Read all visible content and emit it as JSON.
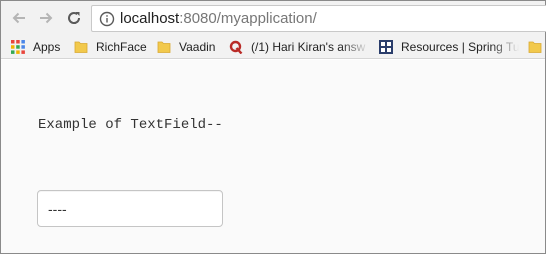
{
  "browser": {
    "url_host": "localhost",
    "url_rest": ":8080/myapplication/"
  },
  "bookmarks": {
    "items": [
      {
        "label": "Apps",
        "icon": "apps-grid-icon"
      },
      {
        "label": "RichFace",
        "icon": "folder-icon"
      },
      {
        "label": "Vaadin",
        "icon": "folder-icon"
      },
      {
        "label": "(/1) Hari Kiran's answ",
        "icon": "quora-icon"
      },
      {
        "label": "Resources | Spring Tu",
        "icon": "spring-site-icon"
      }
    ]
  },
  "page": {
    "heading": "Example of TextField--",
    "text_field_value": "----"
  },
  "colors": {
    "toolbar_bg": "#f2f2f2",
    "content_bg": "#fafafa",
    "folder": "#f2c94c",
    "quora": "#b92b27"
  }
}
